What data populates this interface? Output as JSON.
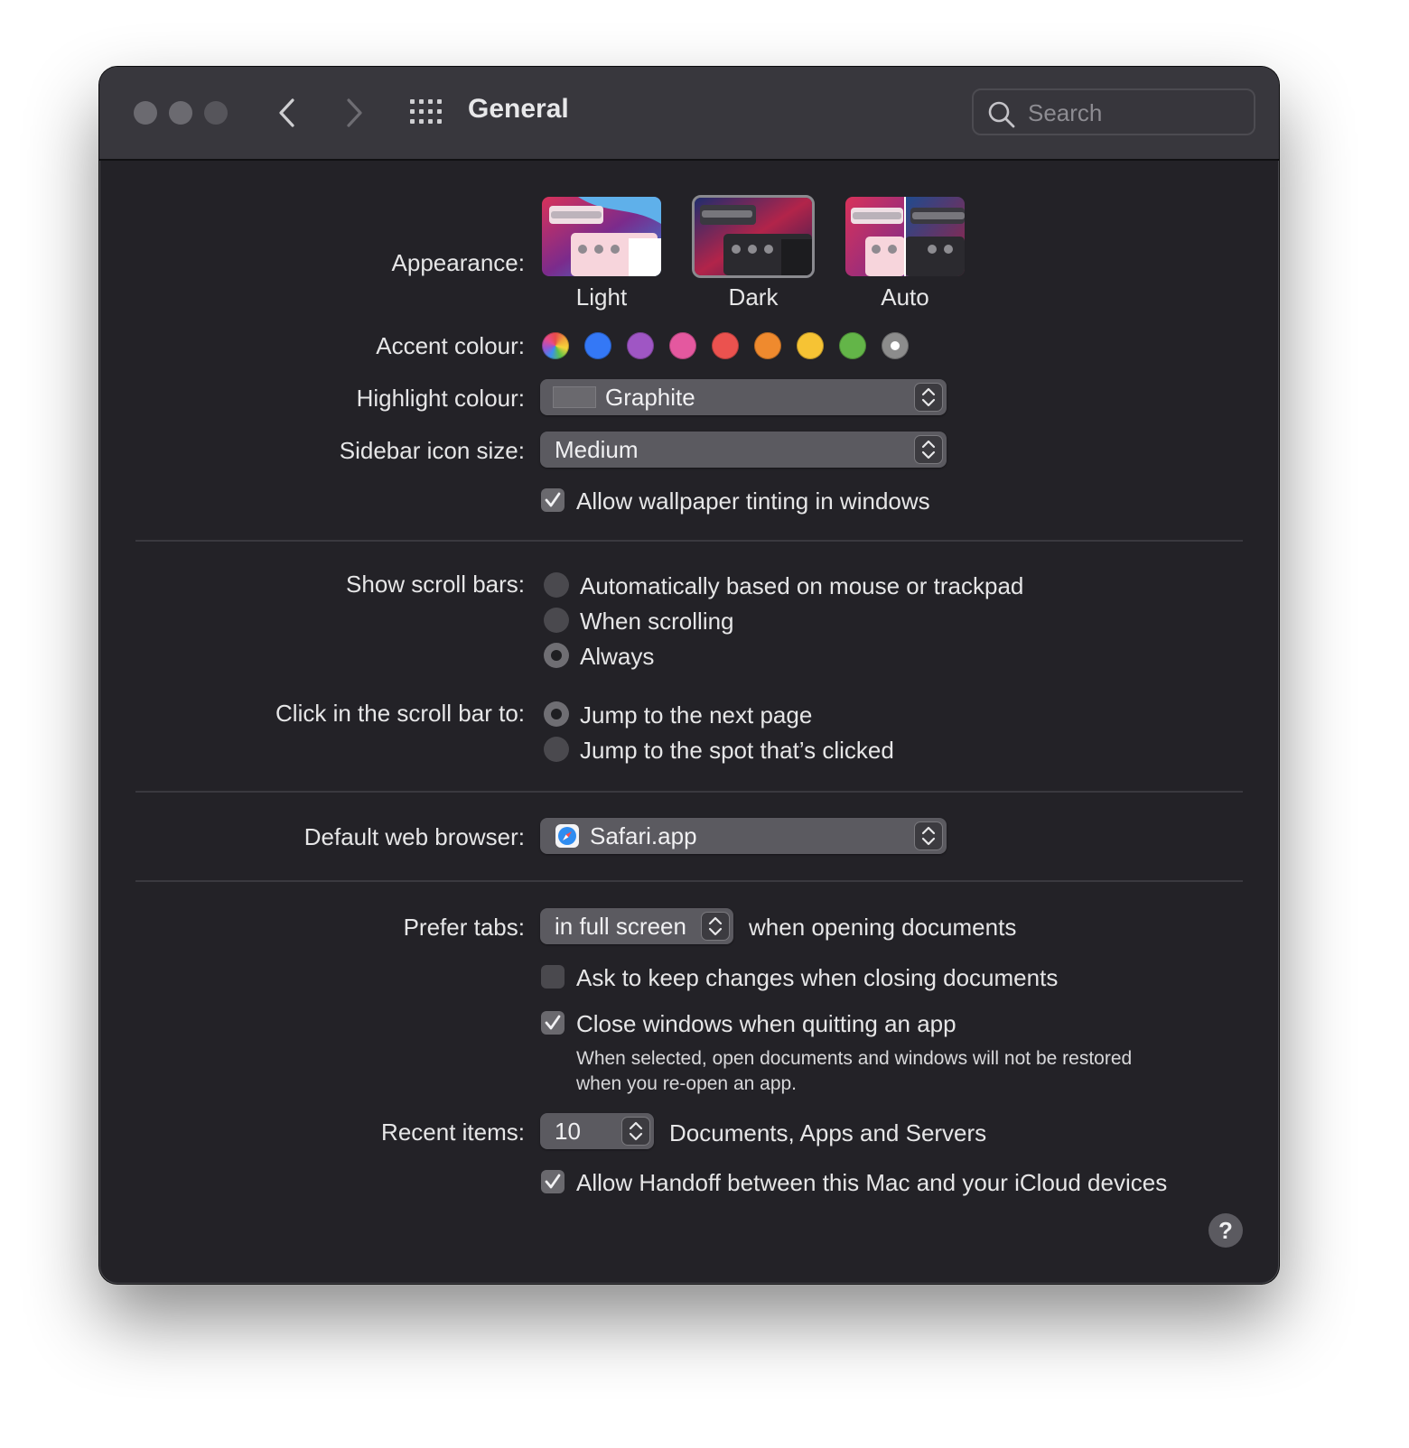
{
  "window": {
    "title": "General",
    "search_placeholder": "Search"
  },
  "appearance": {
    "label": "Appearance:",
    "options": [
      {
        "label": "Light",
        "selected": false
      },
      {
        "label": "Dark",
        "selected": true
      },
      {
        "label": "Auto",
        "selected": false
      }
    ]
  },
  "accent": {
    "label": "Accent colour:",
    "colors": [
      "multicolor",
      "#3478f6",
      "#9f56c4",
      "#e4589f",
      "#eb524f",
      "#ef8a2e",
      "#f6c334",
      "#63b548",
      "#8c8c8c"
    ],
    "selected_index": 8
  },
  "highlight": {
    "label": "Highlight colour:",
    "value": "Graphite",
    "swatch_color": "#5d5c61"
  },
  "sidebar_icon_size": {
    "label": "Sidebar icon size:",
    "value": "Medium"
  },
  "wallpaper_tinting": {
    "label": "Allow wallpaper tinting in windows",
    "checked": true
  },
  "scroll_bars": {
    "label": "Show scroll bars:",
    "options": [
      {
        "label": "Automatically based on mouse or trackpad",
        "selected": false
      },
      {
        "label": "When scrolling",
        "selected": false
      },
      {
        "label": "Always",
        "selected": true
      }
    ]
  },
  "click_scroll": {
    "label": "Click in the scroll bar to:",
    "options": [
      {
        "label": "Jump to the next page",
        "selected": true
      },
      {
        "label": "Jump to the spot that’s clicked",
        "selected": false
      }
    ]
  },
  "browser": {
    "label": "Default web browser:",
    "value": "Safari.app"
  },
  "prefer_tabs": {
    "label": "Prefer tabs:",
    "value": "in full screen",
    "suffix": "when opening documents"
  },
  "ask_keep_changes": {
    "label": "Ask to keep changes when closing documents",
    "checked": false
  },
  "close_windows": {
    "label": "Close windows when quitting an app",
    "checked": true,
    "note_line1": "When selected, open documents and windows will not be restored",
    "note_line2": "when you re-open an app."
  },
  "recent_items": {
    "label": "Recent items:",
    "value": "10",
    "suffix": "Documents, Apps and Servers"
  },
  "handoff": {
    "label": "Allow Handoff between this Mac and your iCloud devices",
    "checked": true
  },
  "help": {
    "label": "?"
  }
}
